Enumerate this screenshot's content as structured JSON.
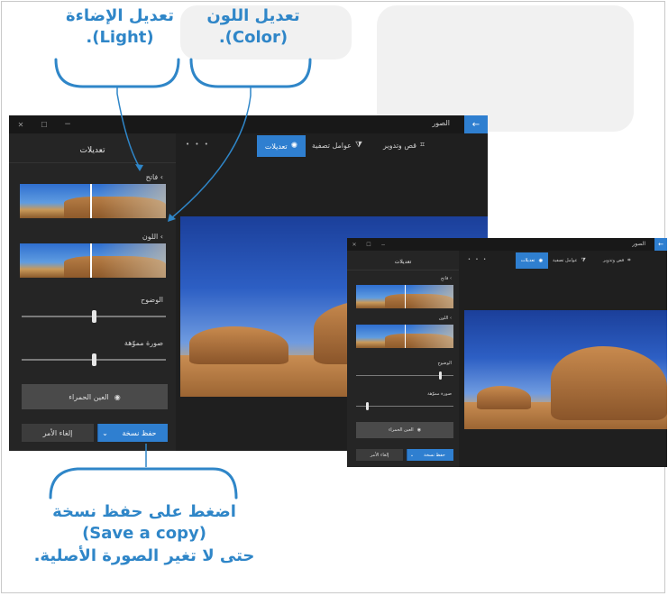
{
  "callouts": {
    "light": {
      "line1": "تعديل الإضاءة",
      "line2": "(Light)."
    },
    "color": {
      "line1": "تعديل اللون",
      "line2": "(Color)."
    },
    "save": {
      "line1": "اضغط على حفظ نسخة",
      "line2": "(Save a copy)",
      "line3": "حتى لا تغير الصورة الأصلية."
    }
  },
  "window": {
    "title": "الصور",
    "controls": {
      "close": "✕",
      "maximize": "☐",
      "minimize": "−"
    },
    "back_icon": "←",
    "toolbar": {
      "crop_rotate": "قص وتدوير",
      "filters": "عوامل تصفية",
      "adjustments": "تعديلات",
      "more": "• • •"
    },
    "panel": {
      "title": "تعديلات",
      "light_label": "فاتح",
      "color_label": "اللون",
      "vignette_label": "الوضوح",
      "blurred_label": "صورة مموّهة",
      "redeye_button": "العين الحمراء",
      "save_copy_button": "حفظ نسخة",
      "cancel_button": "إلغاء الأمر"
    },
    "sliders": {
      "clarity": 0.5,
      "vignette": 0.5
    }
  },
  "window_small": {
    "sliders": {
      "clarity": 0.85,
      "vignette": 0.1
    }
  },
  "colors": {
    "accent": "#2f86c8",
    "app_accent": "#2f7fd0"
  }
}
